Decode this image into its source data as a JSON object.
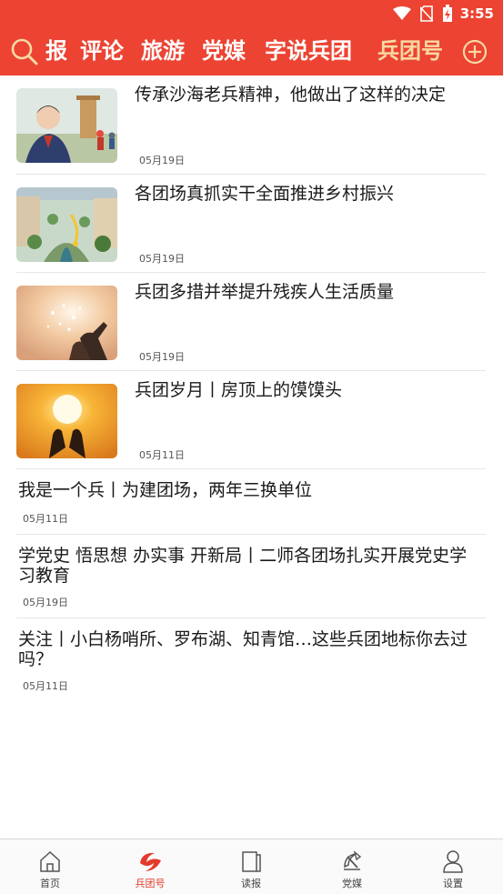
{
  "status_bar": {
    "time": "3:55",
    "icons": [
      "wifi-icon",
      "no-sim-icon",
      "battery-charging-icon"
    ]
  },
  "top_nav": {
    "search_icon": "search-icon",
    "tabs": [
      "报",
      "评论",
      "旅游",
      "党媒",
      "字说兵团",
      "兵团号"
    ],
    "active_tab": "兵团号",
    "add_icon": "plus-circle-icon",
    "accent_color": "#ec4332",
    "active_color": "#f7d9a3"
  },
  "articles": [
    {
      "title": "传承沙海老兵精神，他做出了这样的决定",
      "date": "05月19日",
      "has_thumb": true
    },
    {
      "title": "各团场真抓实干全面推进乡村振兴",
      "date": "05月19日",
      "has_thumb": true
    },
    {
      "title": "兵团多措并举提升残疾人生活质量",
      "date": "05月19日",
      "has_thumb": true
    },
    {
      "title": "兵团岁月丨房顶上的馍馍头",
      "date": "05月11日",
      "has_thumb": true
    },
    {
      "title": "我是一个兵丨为建团场，两年三换单位",
      "date": "05月11日",
      "has_thumb": false
    },
    {
      "title": "学党史 悟思想 办实事 开新局丨二师各团场扎实开展党史学习教育",
      "date": "05月19日",
      "has_thumb": false
    },
    {
      "title": "关注丨小白杨哨所、罗布湖、知青馆…这些兵团地标你去过吗？",
      "date": "05月11日",
      "has_thumb": false
    }
  ],
  "bottom_nav": {
    "items": [
      {
        "label": "首页",
        "icon": "home-icon"
      },
      {
        "label": "兵团号",
        "icon": "bingtuan-logo-icon"
      },
      {
        "label": "读报",
        "icon": "newspaper-icon"
      },
      {
        "label": "党媒",
        "icon": "party-emblem-icon"
      },
      {
        "label": "设置",
        "icon": "user-icon"
      }
    ],
    "active": "兵团号"
  }
}
